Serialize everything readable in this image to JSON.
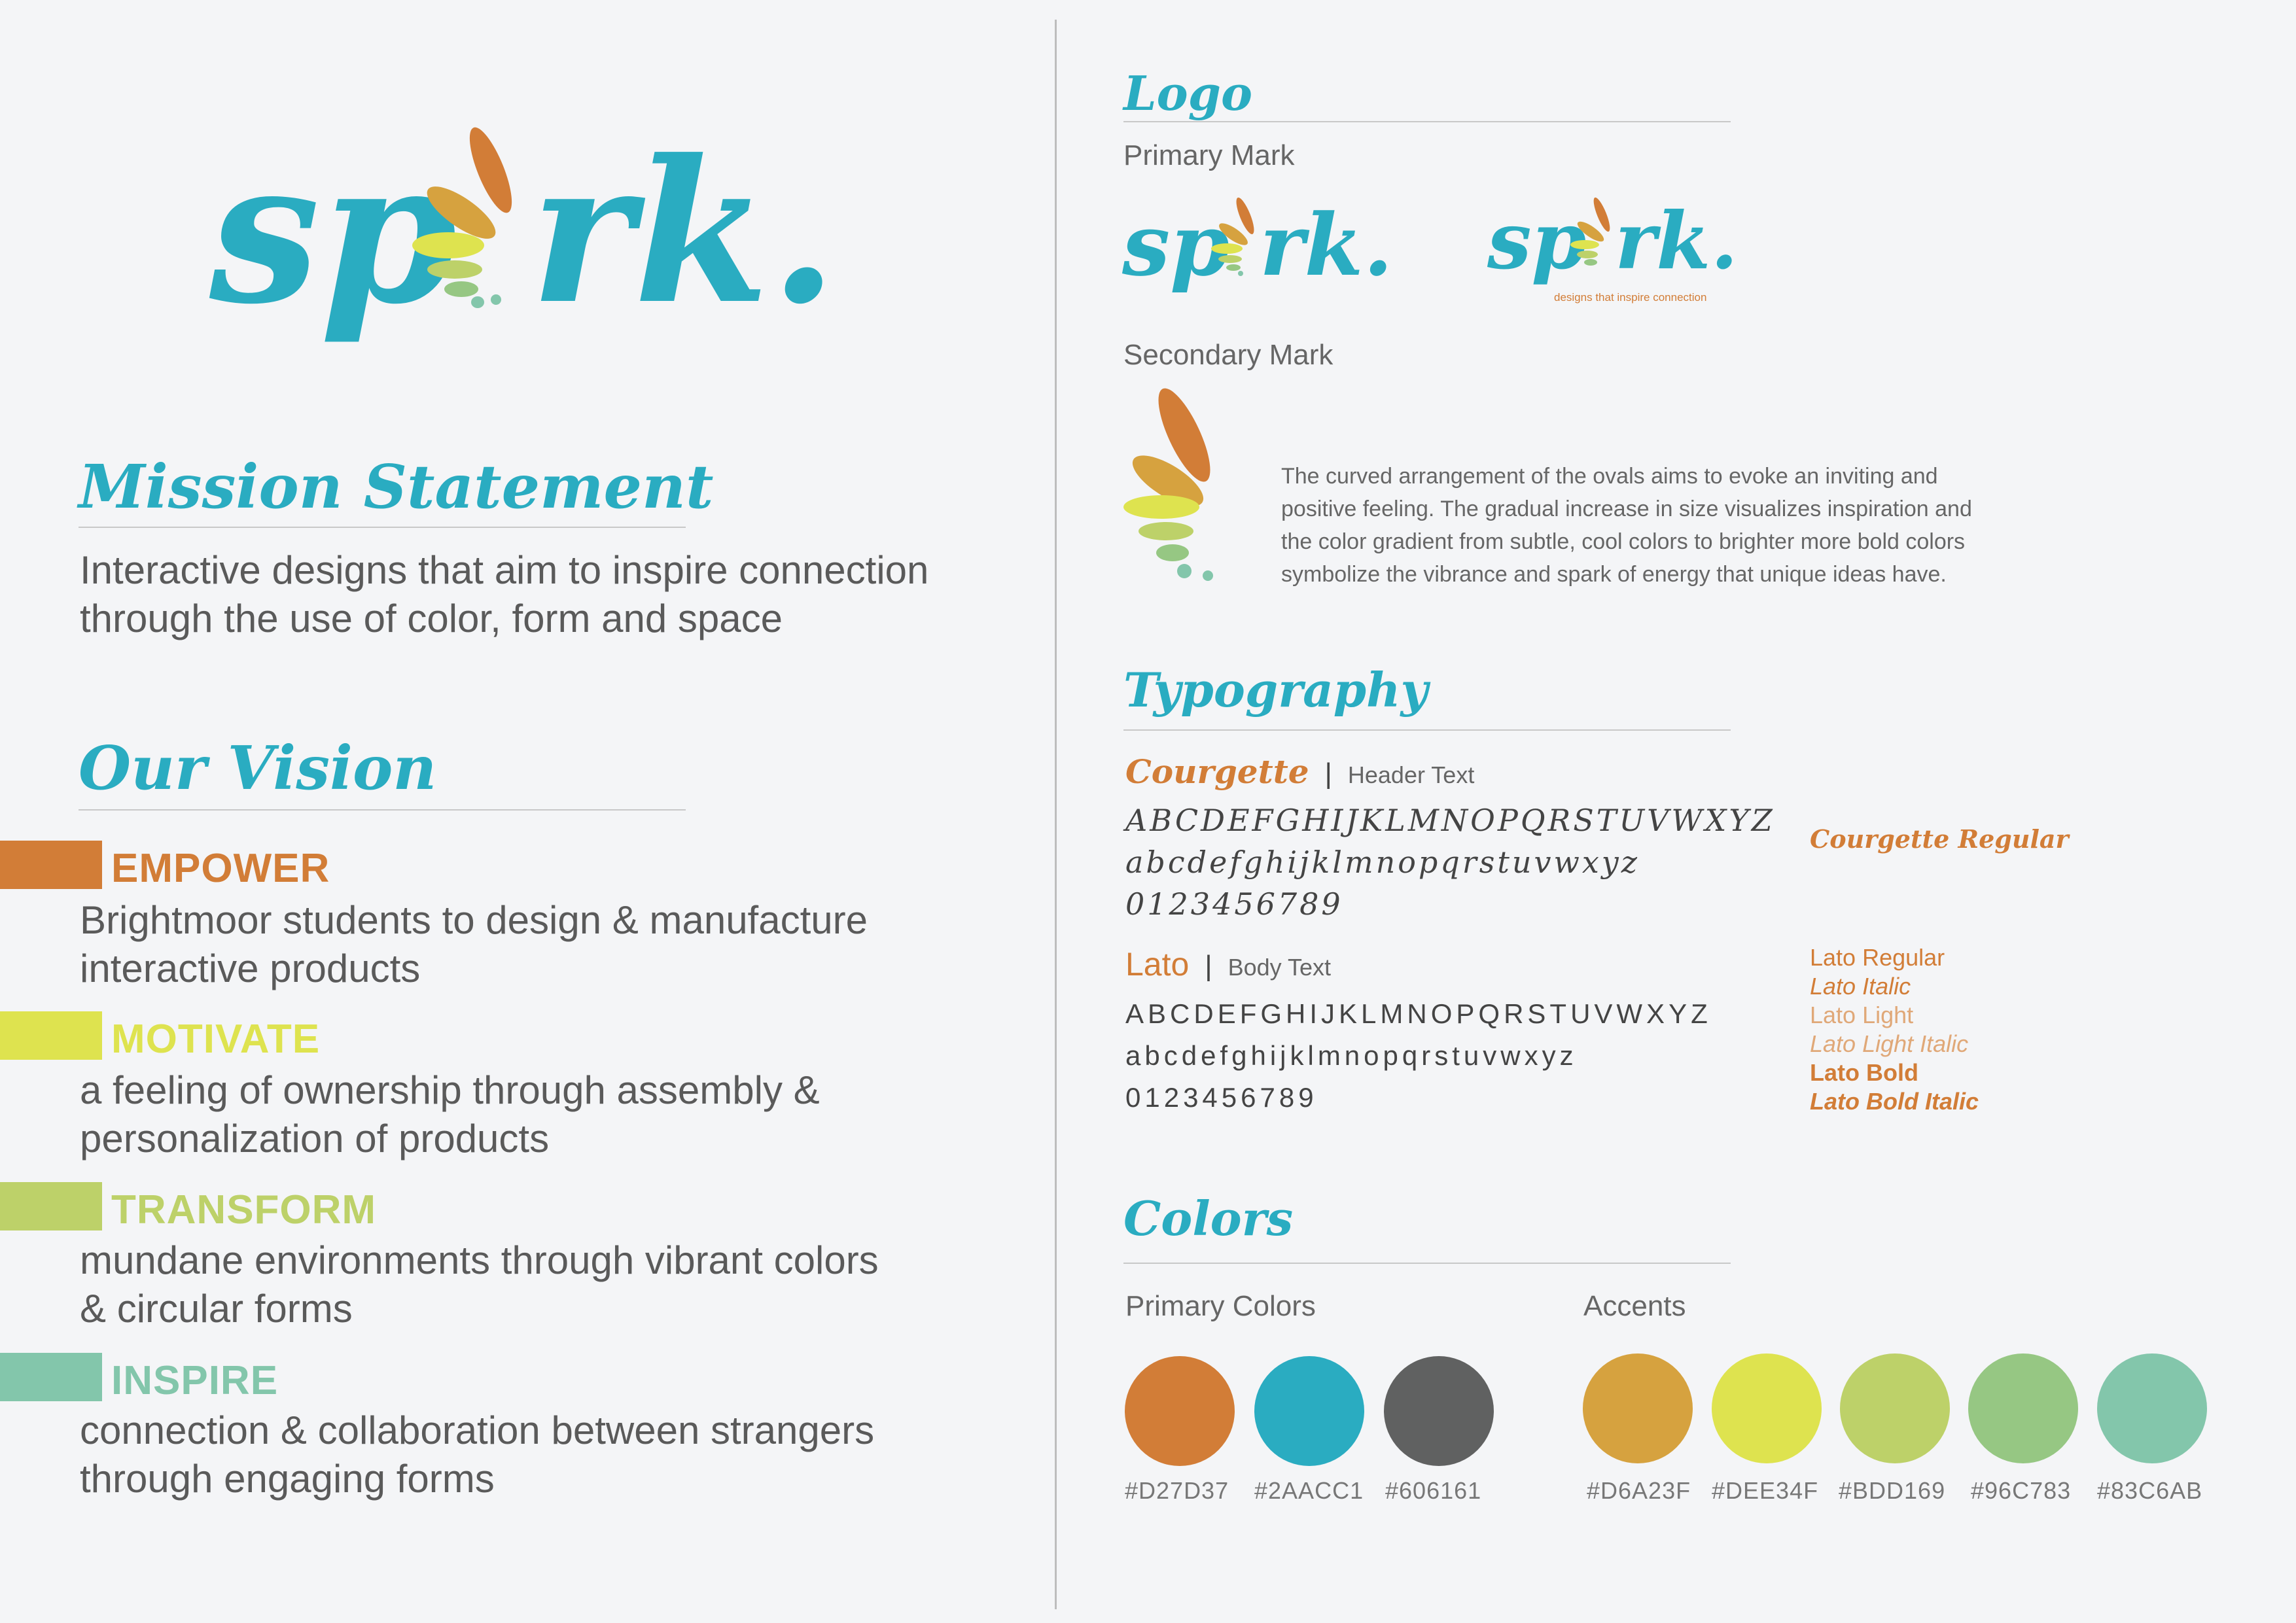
{
  "brand": {
    "logo_text": "spark.",
    "tagline": "designs that inspire connection"
  },
  "mission": {
    "title": "Mission Statement",
    "text_line1": "Interactive designs that aim to inspire connection",
    "text_line2": "through the use of color, form and space"
  },
  "vision": {
    "title": "Our Vision",
    "items": [
      {
        "head": "EMPOWER",
        "line1": "Brightmoor students to design & manufacture",
        "line2": "interactive products",
        "color": "#D27D37"
      },
      {
        "head": "MOTIVATE",
        "line1": "a feeling of ownership through assembly &",
        "line2": "personalization of products",
        "color": "#DEE34F"
      },
      {
        "head": "TRANSFORM",
        "line1": "mundane environments through vibrant colors",
        "line2": "& circular forms",
        "color": "#BDD169"
      },
      {
        "head": "INSPIRE",
        "line1": "connection & collaboration between strangers",
        "line2": "through engaging forms",
        "color": "#83C6AB"
      }
    ]
  },
  "logo_section": {
    "title": "Logo",
    "primary_label": "Primary Mark",
    "secondary_label": "Secondary Mark",
    "description_lines": [
      "The curved arrangement of the ovals aims to evoke an inviting and",
      "positive feeling. The gradual increase in size visualizes inspiration and",
      "the color gradient from subtle, cool colors to brighter more bold colors",
      "symbolize the vibrance and spark of energy that unique ideas have."
    ]
  },
  "typography": {
    "title": "Typography",
    "header_font": "Courgette",
    "header_sep": "|",
    "header_usage": "Header Text",
    "header_upper": "ABCDEFGHIJKLMNOPQRSTUVWXYZ",
    "header_lower": "abcdefghijklmnopqrstuvwxyz",
    "header_digits": "0123456789",
    "header_style": "Courgette Regular",
    "body_font": "Lato",
    "body_sep": "|",
    "body_usage": "Body Text",
    "body_upper": "ABCDEFGHIJKLMNOPQRSTUVWXYZ",
    "body_lower": "abcdefghijklmnopqrstuvwxyz",
    "body_digits": "0123456789",
    "body_styles": [
      "Lato Regular",
      "Lato Italic",
      "Lato Light",
      "Lato Light Italic",
      "Lato Bold",
      "Lato Bold Italic"
    ]
  },
  "colors": {
    "title": "Colors",
    "primary_label": "Primary Colors",
    "accents_label": "Accents",
    "primary": [
      "#D27D37",
      "#2AACC1",
      "#606161"
    ],
    "accents": [
      "#D6A23F",
      "#DEE34F",
      "#BDD169",
      "#96C783",
      "#83C6AB"
    ]
  }
}
